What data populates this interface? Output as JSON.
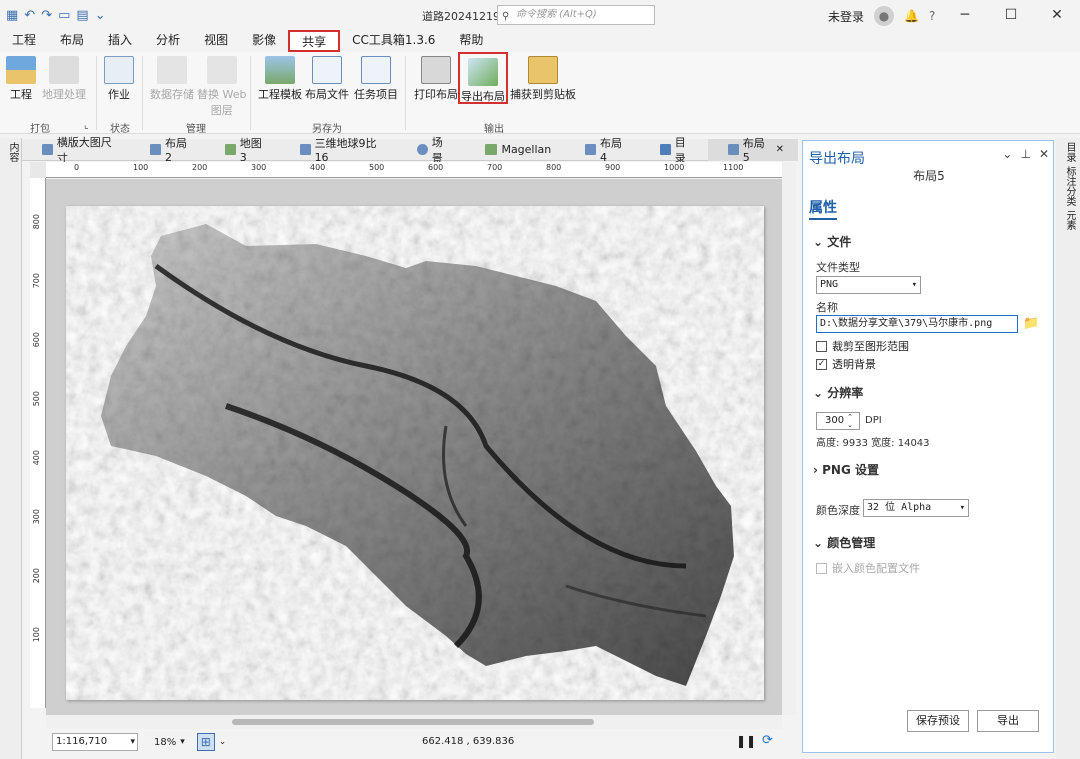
{
  "app": {
    "title": "道路20241219",
    "command_search_placeholder": "命令搜索 (Alt+Q)",
    "user": "未登录",
    "help_label": "?"
  },
  "menu": [
    "工程",
    "布局",
    "插入",
    "分析",
    "视图",
    "影像",
    "共享",
    "CC工具箱1.3.6",
    "帮助"
  ],
  "menu_active": "共享",
  "ribbon": {
    "buttons": {
      "project": "工程",
      "geoprocess": "地理处理",
      "job": "作业",
      "data_store": "数据存储",
      "replace_web_layer_1": "替换 Web",
      "replace_web_layer_2": "图层",
      "project_template": "工程模板",
      "layout_file": "布局文件",
      "task_item": "任务项目",
      "print_layout": "打印布局",
      "export_layout": "导出布局",
      "capture_clipboard": "捕获到剪贴板"
    },
    "groups": {
      "pack": "打包",
      "status": "状态",
      "manage": "管理",
      "save_as": "另存为",
      "output": "输出"
    }
  },
  "left_rail": "内容",
  "right_rail": [
    "目录",
    "标注分类",
    "元素"
  ],
  "tabs": [
    {
      "label": "横版大图尺寸"
    },
    {
      "label": "布局2"
    },
    {
      "label": "地图3"
    },
    {
      "label": "三维地球9比16"
    },
    {
      "label": "场景"
    },
    {
      "label": "Magellan"
    },
    {
      "label": "布局4"
    },
    {
      "label": "目录"
    },
    {
      "label": "布局5"
    }
  ],
  "ruler_h": [
    "0",
    "100",
    "200",
    "300",
    "400",
    "500",
    "600",
    "700",
    "800",
    "900",
    "1000",
    "1100"
  ],
  "ruler_v": [
    "800",
    "700",
    "600",
    "500",
    "400",
    "300",
    "200",
    "100"
  ],
  "status": {
    "scale": "1:116,710",
    "zoom": "18%",
    "coords": "662.418 , 639.836"
  },
  "pane": {
    "title": "导出布局",
    "subtitle": "布局5",
    "properties": "属性",
    "file_section": "文件",
    "file_type_label": "文件类型",
    "file_type_value": "PNG",
    "name_label": "名称",
    "name_value": "D:\\数据分享文章\\379\\马尔康市.png",
    "clip_label": "裁剪至图形范围",
    "clip_checked": false,
    "transparent_label": "透明背景",
    "transparent_checked": true,
    "resolution_section": "分辨率",
    "dpi_value": "300",
    "dpi_unit": "DPI",
    "dimensions": "高度: 9933 宽度: 14043",
    "png_section": "PNG 设置",
    "color_depth_label": "颜色深度",
    "color_depth_value": "32 位 Alpha",
    "color_mgmt_section": "颜色管理",
    "embed_profile_label": "嵌入颜色配置文件",
    "save_preset": "保存预设",
    "export": "导出"
  },
  "colors": {
    "accent": "#1e5fa8",
    "highlight_border": "#d32f2f"
  }
}
